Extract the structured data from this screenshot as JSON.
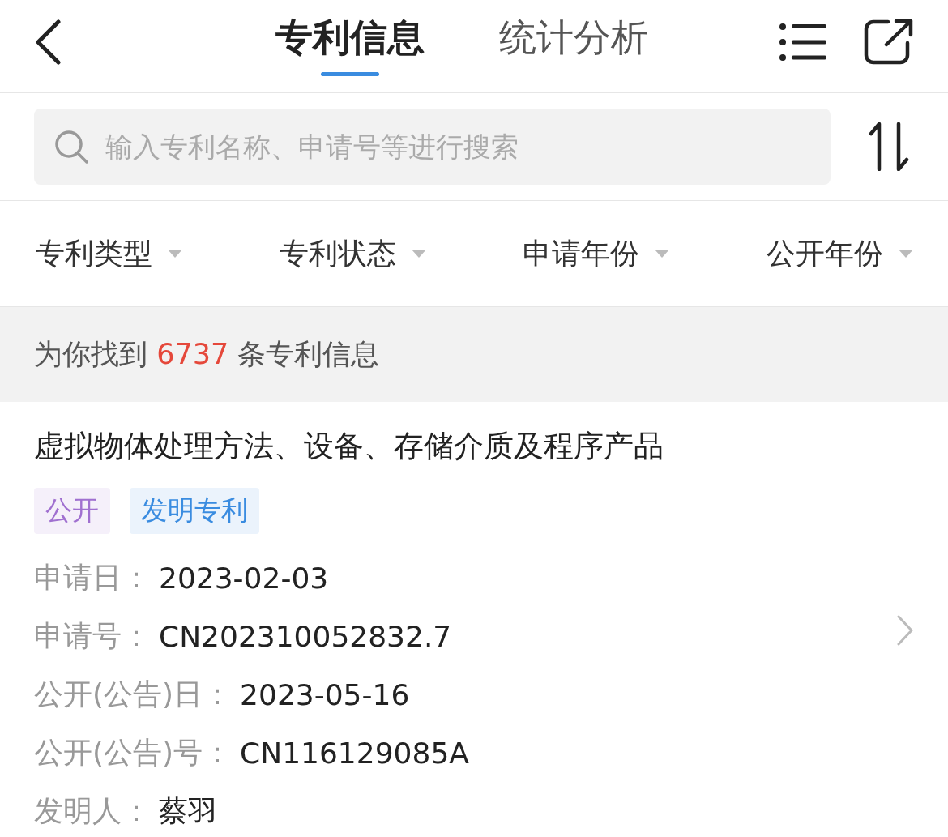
{
  "header": {
    "tabs": [
      {
        "label": "专利信息",
        "selected": true
      },
      {
        "label": "统计分析",
        "selected": false
      }
    ]
  },
  "search": {
    "placeholder": "输入专利名称、申请号等进行搜索"
  },
  "filters": [
    {
      "label": "专利类型"
    },
    {
      "label": "专利状态"
    },
    {
      "label": "申请年份"
    },
    {
      "label": "公开年份"
    }
  ],
  "summary": {
    "prefix": "为你找到",
    "count": "6737",
    "suffix": "条专利信息"
  },
  "patents": [
    {
      "title": "虚拟物体处理方法、设备、存储介质及程序产品",
      "tags": [
        {
          "label": "公开",
          "color": "#a070d0"
        },
        {
          "label": "发明专利",
          "color": "#3a8ce0"
        }
      ],
      "fields": [
        {
          "label": "申请日：",
          "value": "2023-02-03"
        },
        {
          "label": "申请号：",
          "value": "CN202310052832.7"
        },
        {
          "label": "公开(公告)日：",
          "value": "2023-05-16"
        },
        {
          "label": "公开(公告)号：",
          "value": "CN116129085A"
        },
        {
          "label": "发明人：",
          "value": "蔡羽"
        }
      ]
    }
  ]
}
